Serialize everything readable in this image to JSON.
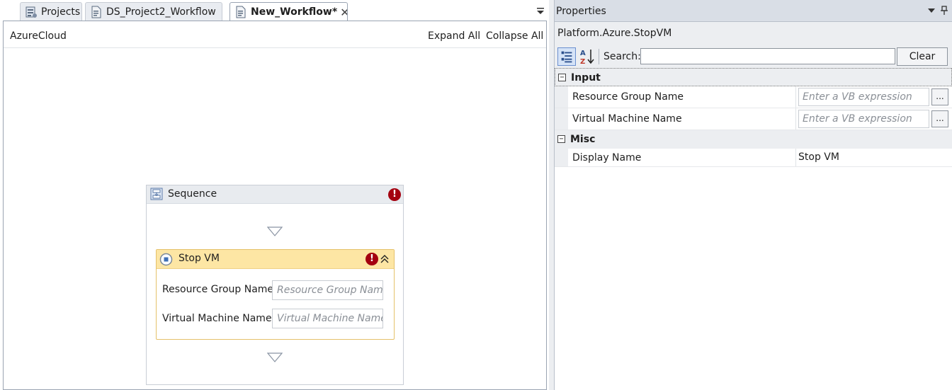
{
  "tabs": [
    {
      "label": "Projects",
      "icon": "projects-icon"
    },
    {
      "label": "DS_Project2_Workflow",
      "icon": "workflow-doc-icon"
    },
    {
      "label": "New_Workflow*",
      "icon": "workflow-doc-icon",
      "active": true,
      "close": "✕"
    }
  ],
  "designer": {
    "breadcrumb": "AzureCloud",
    "expand_all": "Expand All",
    "collapse_all": "Collapse All",
    "sequence": {
      "title": "Sequence",
      "error_glyph": "!",
      "activity": {
        "title": "Stop VM",
        "error_glyph": "!",
        "fields": [
          {
            "label": "Resource Group Name",
            "placeholder": "Resource Group Name"
          },
          {
            "label": "Virtual Machine Name",
            "placeholder": "Virtual Machine Name"
          }
        ]
      }
    }
  },
  "properties": {
    "title": "Properties",
    "object": "Platform.Azure.StopVM",
    "search_label": "Search:",
    "search_value": "",
    "clear_label": "Clear",
    "categories": {
      "input": {
        "label": "Input",
        "toggle": "−",
        "rows": [
          {
            "name": "Resource Group Name",
            "placeholder": "Enter a VB expression",
            "button": "..."
          },
          {
            "name": "Virtual Machine Name",
            "placeholder": "Enter a VB expression",
            "button": "..."
          }
        ]
      },
      "misc": {
        "label": "Misc",
        "toggle": "−",
        "rows": [
          {
            "name": "Display Name",
            "value": "Stop VM"
          }
        ]
      }
    }
  },
  "colors": {
    "activity_header": "#fde6a4",
    "activity_border": "#e5c16a",
    "error": "#a4000f",
    "panel_title": "#d9dee6"
  }
}
